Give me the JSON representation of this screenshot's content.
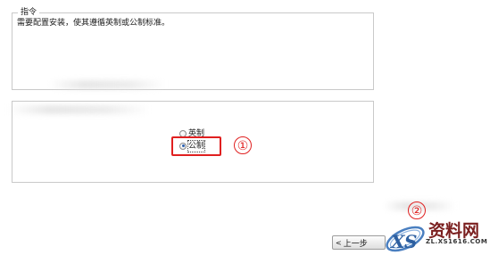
{
  "instruction_group": {
    "title": "指令",
    "text": "需要配置安装，使其遵循英制或公制标准。"
  },
  "units": {
    "options": [
      {
        "label": "英制",
        "checked": false
      },
      {
        "label": "公制",
        "checked": true
      }
    ]
  },
  "annotations": {
    "callout_1": "①",
    "callout_2": "②",
    "accent_color": "#e02020"
  },
  "navigation": {
    "prev_label": "上一步",
    "prev_icon": "chevron-left-icon"
  },
  "watermark": {
    "brand": "资料网",
    "url": "ZL.XS1616.COM"
  }
}
